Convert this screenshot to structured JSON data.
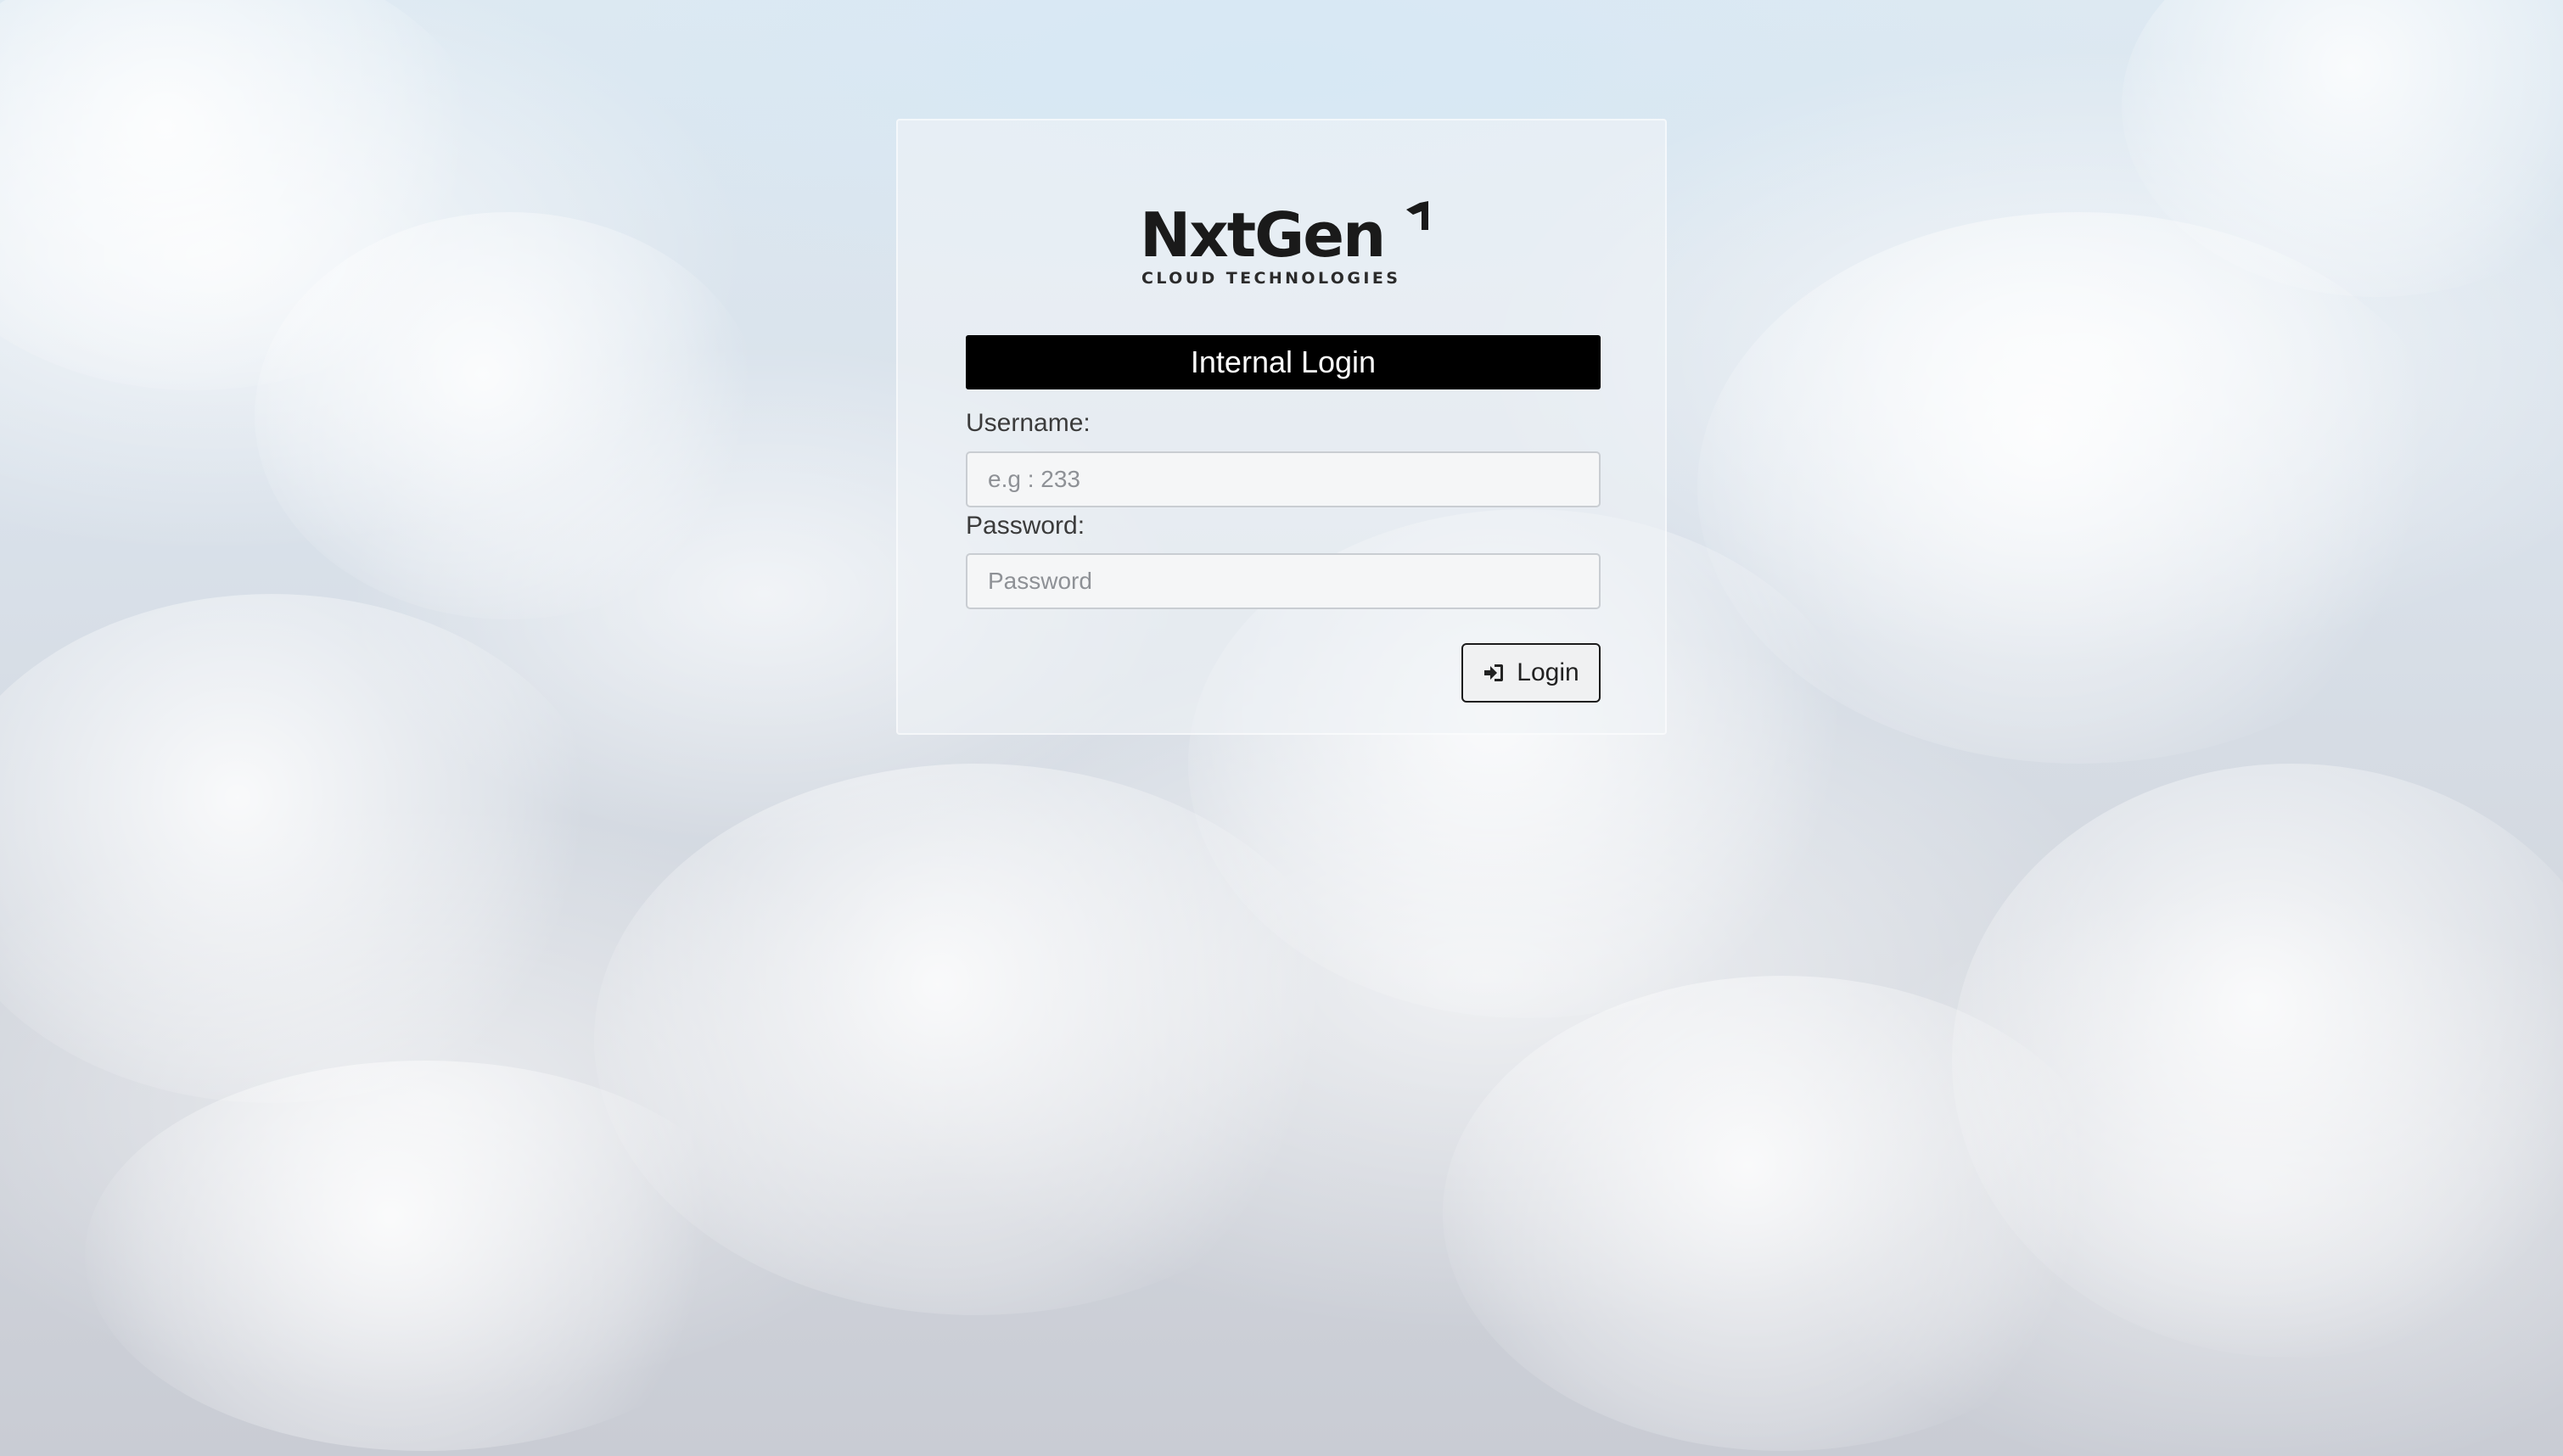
{
  "brand": {
    "wordmark": "NxtGen",
    "tagline": "CLOUD TECHNOLOGIES",
    "logo_icon": "arrow-up-right-icon",
    "text_color": "#1a1a1a"
  },
  "login_form": {
    "title": "Internal Login",
    "title_background": "#000000",
    "username": {
      "label": "Username:",
      "placeholder": "e.g : 233",
      "value": ""
    },
    "password": {
      "label": "Password:",
      "placeholder": "Password",
      "value": ""
    },
    "submit": {
      "label": "Login",
      "icon": "sign-in-icon"
    }
  },
  "background": {
    "theme": "clouds",
    "colors": [
      "#dde9f2",
      "#d2d6dd",
      "#ffffff"
    ]
  }
}
